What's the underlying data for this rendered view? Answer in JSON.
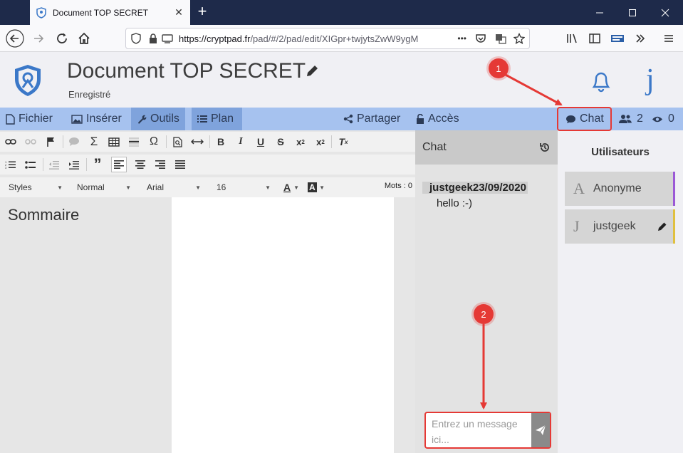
{
  "browser": {
    "tab_title": "Document TOP SECRET",
    "tab_close": "✕",
    "new_tab": "+",
    "url_host": "https://cryptpad.fr",
    "url_path": "/pad/#/2/pad/edit/XIGpr+twjytsZwW9ygM",
    "url_more": "•••"
  },
  "header": {
    "title": "Document TOP SECRET",
    "status": "Enregistré",
    "user_initial": "j"
  },
  "toolbar": {
    "fichier": "Fichier",
    "inserer": "Insérer",
    "outils": "Outils",
    "plan": "Plan",
    "partager": "Partager",
    "acces": "Accès",
    "chat": "Chat",
    "users_count": "2",
    "viewers_count": "0"
  },
  "editor": {
    "style_combo": "Styles",
    "format_combo": "Normal",
    "font_combo": "Arial",
    "size_combo": "16",
    "word_count": "Mots : 0",
    "outline_title": "Sommaire"
  },
  "chat": {
    "title": "Chat",
    "messages": [
      {
        "author_time": "justgeek23/09/2020",
        "text": "hello :-)"
      }
    ],
    "input_placeholder": "Entrez un message ici..."
  },
  "users": {
    "title": "Utilisateurs",
    "list": [
      {
        "initial": "A",
        "name": "Anonyme",
        "color": "#9b59d6"
      },
      {
        "initial": "J",
        "name": "justgeek",
        "color": "#e0c040"
      }
    ]
  },
  "annotations": {
    "badge_1": "1",
    "badge_2": "2"
  },
  "colors": {
    "accent_blue": "#3b78c8",
    "toolbar_bg": "#a6c2ef",
    "highlight_red": "#e53935"
  }
}
